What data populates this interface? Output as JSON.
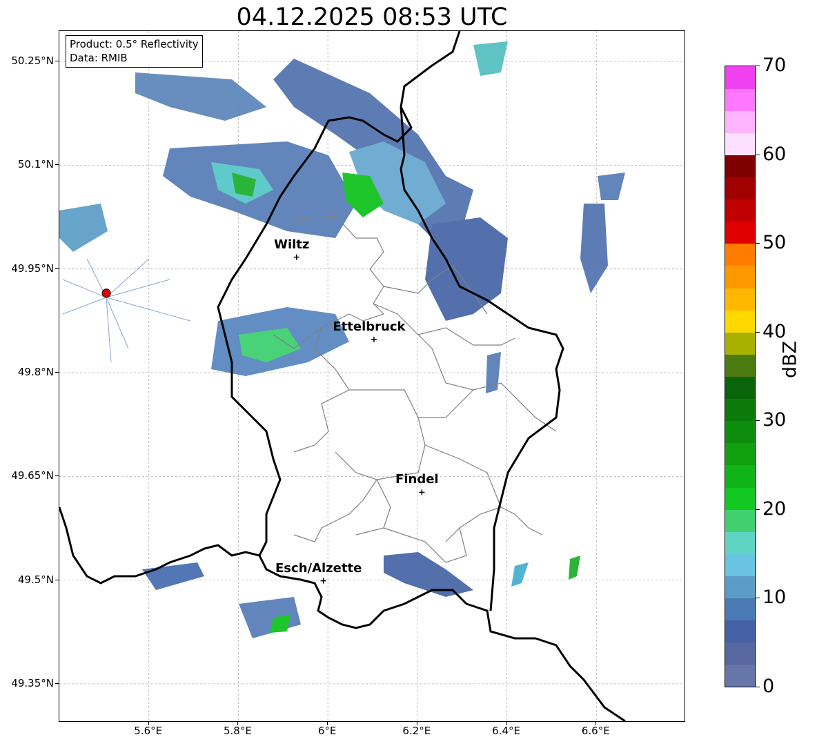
{
  "title": "04.12.2025 08:53 UTC",
  "info": {
    "line1": "Product: 0.5° Reflectivity",
    "line2": "Data: RMIB"
  },
  "map": {
    "lon_range": [
      5.4,
      6.8
    ],
    "lat_range": [
      49.3,
      50.3
    ],
    "lat_ticks": [
      {
        "value": 50.25,
        "label": "50.25°N"
      },
      {
        "value": 50.1,
        "label": "50.1°N"
      },
      {
        "value": 49.95,
        "label": "49.95°N"
      },
      {
        "value": 49.8,
        "label": "49.8°N"
      },
      {
        "value": 49.65,
        "label": "49.65°N"
      },
      {
        "value": 49.5,
        "label": "49.5°N"
      },
      {
        "value": 49.35,
        "label": "49.35°N"
      }
    ],
    "lon_ticks": [
      {
        "value": 5.6,
        "label": "5.6°E"
      },
      {
        "value": 5.8,
        "label": "5.8°E"
      },
      {
        "value": 6.0,
        "label": "6°E"
      },
      {
        "value": 6.2,
        "label": "6.2°E"
      },
      {
        "value": 6.4,
        "label": "6.4°E"
      },
      {
        "value": 6.6,
        "label": "6.6°E"
      }
    ],
    "cities": [
      {
        "name": "Wiltz",
        "lon": 5.93,
        "lat": 49.967
      },
      {
        "name": "Ettelbruck",
        "lon": 6.103,
        "lat": 49.848
      },
      {
        "name": "Findel",
        "lon": 6.21,
        "lat": 49.627
      },
      {
        "name": "Esch/Alzette",
        "lon": 5.99,
        "lat": 49.499
      }
    ],
    "radar_site": {
      "lon": 5.505,
      "lat": 49.915
    },
    "grid": true
  },
  "colorbar": {
    "label": "dBZ",
    "min": 0,
    "max": 70,
    "ticks": [
      0,
      10,
      20,
      30,
      40,
      50,
      60,
      70
    ],
    "colors": [
      "#6676a8",
      "#56689f",
      "#4560a4",
      "#4a7ab4",
      "#5a9cc6",
      "#68c4e0",
      "#60d4c4",
      "#40d070",
      "#10c820",
      "#10b418",
      "#10a010",
      "#0e8c0c",
      "#0b7a0b",
      "#0a640a",
      "#4a7a10",
      "#a8b000",
      "#ffd800",
      "#ffb800",
      "#ff9800",
      "#ff7c00",
      "#e00000",
      "#c00000",
      "#a00000",
      "#800000",
      "#ffe0ff",
      "#ffb4ff",
      "#ff78ff",
      "#f040f0"
    ]
  }
}
